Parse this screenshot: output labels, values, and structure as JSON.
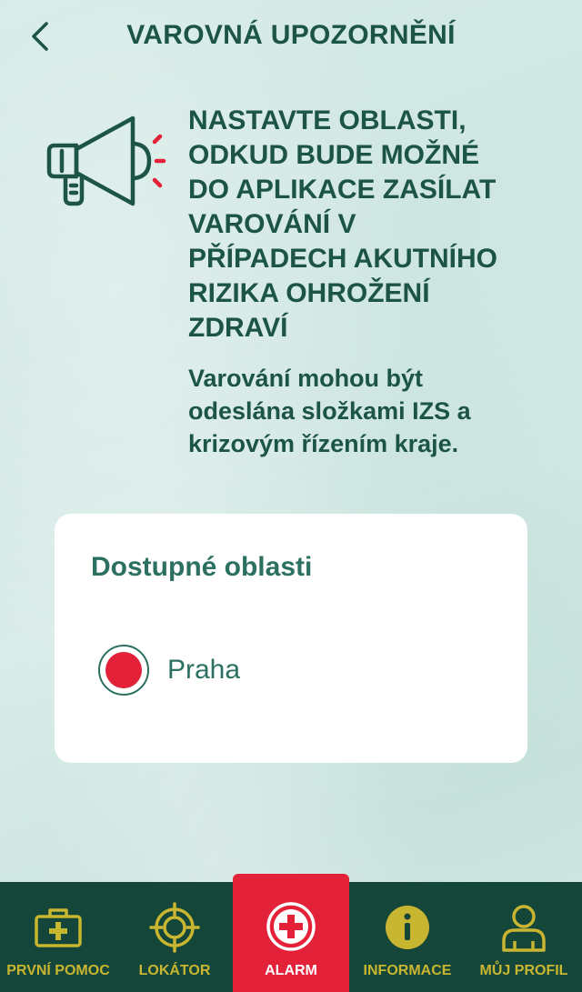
{
  "header": {
    "title": "VAROVNÁ UPOZORNĚNÍ",
    "back_icon": "chevron-left-icon"
  },
  "intro": {
    "icon": "megaphone-icon",
    "headline": "NASTAVTE OBLASTI,\nODKUD BUDE MOŽNÉ\nDO APLIKACE ZASÍLAT\nVAROVÁNÍ V\nPŘÍPADECH AKUTNÍHO\nRIZIKA OHROŽENÍ\nZDRAVÍ",
    "subtext": "Varování mohou být\nodeslána složkami IZS a\nkrizovým řízením kraje."
  },
  "areas": {
    "title": "Dostupné oblasti",
    "options": [
      {
        "label": "Praha",
        "selected": true
      }
    ]
  },
  "tabs": [
    {
      "label": "PRVNÍ POMOC",
      "icon": "first-aid-kit-icon",
      "active": false
    },
    {
      "label": "LOKÁTOR",
      "icon": "crosshair-icon",
      "active": false
    },
    {
      "label": "ALARM",
      "icon": "plus-circle-icon",
      "active": true
    },
    {
      "label": "INFORMACE",
      "icon": "info-icon",
      "active": false
    },
    {
      "label": "MŮJ PROFIL",
      "icon": "user-icon",
      "active": false
    }
  ],
  "colors": {
    "primary_text": "#1c5446",
    "accent_red": "#e3223a",
    "tab_bar": "#15463a",
    "tab_icon": "#c9b630"
  }
}
